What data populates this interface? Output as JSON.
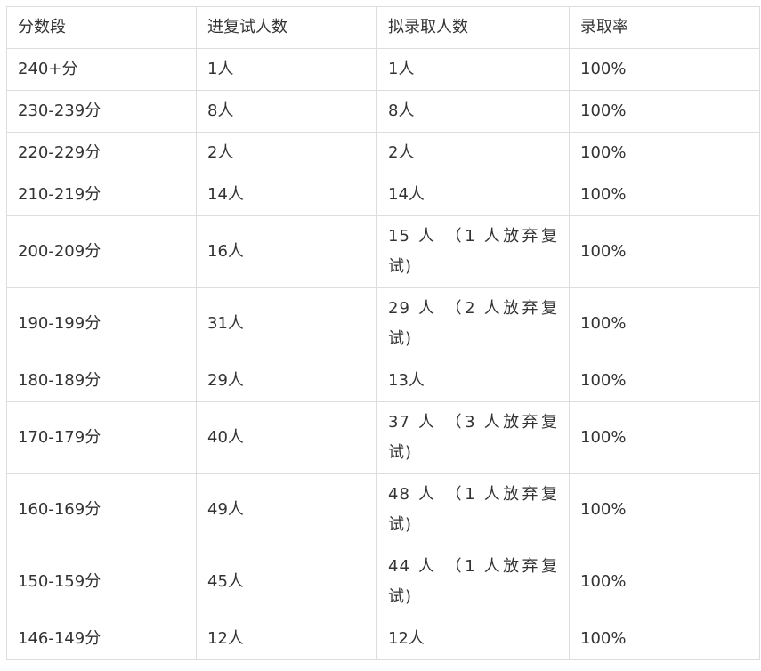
{
  "table": {
    "headers": [
      "分数段",
      "进复试人数",
      "拟录取人数",
      "录取率"
    ],
    "rows": [
      [
        "240+分",
        "1人",
        "1人",
        "100%"
      ],
      [
        "230-239分",
        "8人",
        "8人",
        "100%"
      ],
      [
        "220-229分",
        "2人",
        "2人",
        "100%"
      ],
      [
        "210-219分",
        "14人",
        "14人",
        "100%"
      ],
      [
        "200-209分",
        "16人",
        "15 人 （1 人放弃复试)",
        "100%"
      ],
      [
        "190-199分",
        "31人",
        "29 人 （2 人放弃复试)",
        "100%"
      ],
      [
        "180-189分",
        "29人",
        "13人",
        "100%"
      ],
      [
        "170-179分",
        "40人",
        "37 人 （3 人放弃复试)",
        "100%"
      ],
      [
        "160-169分",
        "49人",
        "48 人 （1 人放弃复试)",
        "100%"
      ],
      [
        "150-159分",
        "45人",
        "44 人 （1 人放弃复试)",
        "100%"
      ],
      [
        "146-149分",
        "12人",
        "12人",
        "100%"
      ]
    ]
  }
}
